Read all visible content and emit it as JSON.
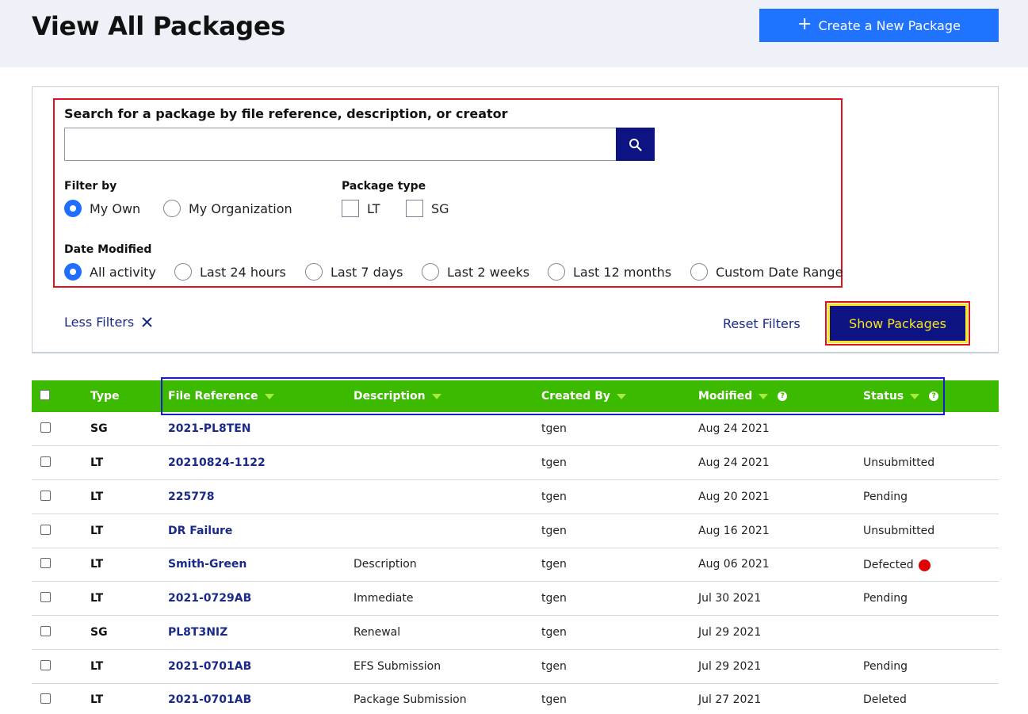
{
  "header": {
    "title": "View All Packages",
    "create_label": "Create a New Package"
  },
  "search": {
    "label": "Search for a package by file reference, description, or creator",
    "value": "",
    "placeholder": ""
  },
  "filters": {
    "filter_by": {
      "label": "Filter by",
      "options": [
        {
          "label": "My Own",
          "selected": true
        },
        {
          "label": "My Organization",
          "selected": false
        }
      ]
    },
    "package_type": {
      "label": "Package type",
      "options": [
        {
          "label": "LT",
          "checked": false
        },
        {
          "label": "SG",
          "checked": false
        }
      ]
    },
    "date_modified": {
      "label": "Date Modified",
      "options": [
        {
          "label": "All activity",
          "selected": true
        },
        {
          "label": "Last 24 hours",
          "selected": false
        },
        {
          "label": "Last 7 days",
          "selected": false
        },
        {
          "label": "Last 2 weeks",
          "selected": false
        },
        {
          "label": "Last 12 months",
          "selected": false
        },
        {
          "label": "Custom Date Range",
          "selected": false
        }
      ]
    }
  },
  "actions": {
    "less_filters": "Less Filters",
    "reset_filters": "Reset Filters",
    "show_packages": "Show Packages"
  },
  "table": {
    "columns": [
      "Type",
      "File Reference",
      "Description",
      "Created By",
      "Modified",
      "Status"
    ],
    "rows": [
      {
        "type": "SG",
        "ref": "2021-PL8TEN",
        "desc": "",
        "by": "tgen",
        "modified": "Aug 24 2021",
        "status": ""
      },
      {
        "type": "LT",
        "ref": "20210824-1122",
        "desc": "",
        "by": "tgen",
        "modified": "Aug 24 2021",
        "status": "Unsubmitted"
      },
      {
        "type": "LT",
        "ref": "225778",
        "desc": "",
        "by": "tgen",
        "modified": "Aug 20 2021",
        "status": "Pending"
      },
      {
        "type": "LT",
        "ref": "DR Failure",
        "desc": "",
        "by": "tgen",
        "modified": "Aug 16 2021",
        "status": "Unsubmitted"
      },
      {
        "type": "LT",
        "ref": "Smith-Green",
        "desc": "Description",
        "by": "tgen",
        "modified": "Aug 06 2021",
        "status": "Defected"
      },
      {
        "type": "LT",
        "ref": "2021-0729AB",
        "desc": "Immediate",
        "by": "tgen",
        "modified": "Jul 30 2021",
        "status": "Pending"
      },
      {
        "type": "SG",
        "ref": "PL8T3NIZ",
        "desc": "Renewal",
        "by": "tgen",
        "modified": "Jul 29 2021",
        "status": ""
      },
      {
        "type": "LT",
        "ref": "2021-0701AB",
        "desc": "EFS Submission",
        "by": "tgen",
        "modified": "Jul 29 2021",
        "status": "Pending"
      },
      {
        "type": "LT",
        "ref": "2021-0701AB",
        "desc": "Package Submission",
        "by": "tgen",
        "modified": "Jul 27 2021",
        "status": "Deleted"
      }
    ]
  },
  "colors": {
    "primary_blue": "#1f73ff",
    "navy": "#0d1382",
    "table_header_green": "#3cba00",
    "highlight_red": "#e0101d",
    "highlight_yellow": "#f7e61b",
    "highlight_blue": "#1520c8",
    "defected_dot": "#e00000"
  }
}
